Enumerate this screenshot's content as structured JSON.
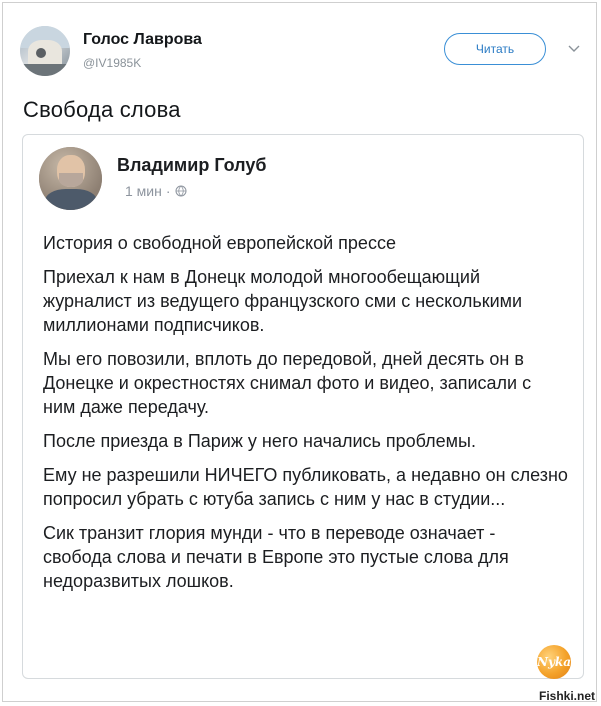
{
  "account": {
    "name": "Голос Лаврова",
    "handle": "@IV1985K",
    "follow_label": "Читать"
  },
  "tweet": {
    "text": "Свобода слова"
  },
  "embedded_post": {
    "author": "Владимир Голуб",
    "time": "1 мин",
    "separator": "·",
    "paragraphs": [
      "История о свободной европейской прессе",
      "Приехал к нам в Донецк молодой многообещающий журналист из ведущего французского сми с несколькими миллионами подписчиков.",
      "Мы его повозили, вплоть до передовой, дней десять он в Донецке и окрестностях снимал фото и видео, записали с ним даже передачу.",
      "После приезда в Париж у него начались проблемы.",
      "Ему не разрешили НИЧЕГО публиковать, а недавно он слезно попросил убрать с ютуба запись с ним у нас в студии...",
      "Сик транзит глория мунди - что в переводе означает - свобода слова и печати в Европе это пустые слова для недоразвитых лошков."
    ]
  },
  "watermark": {
    "logo_text": "Nyka",
    "site": "Fishki.net"
  }
}
